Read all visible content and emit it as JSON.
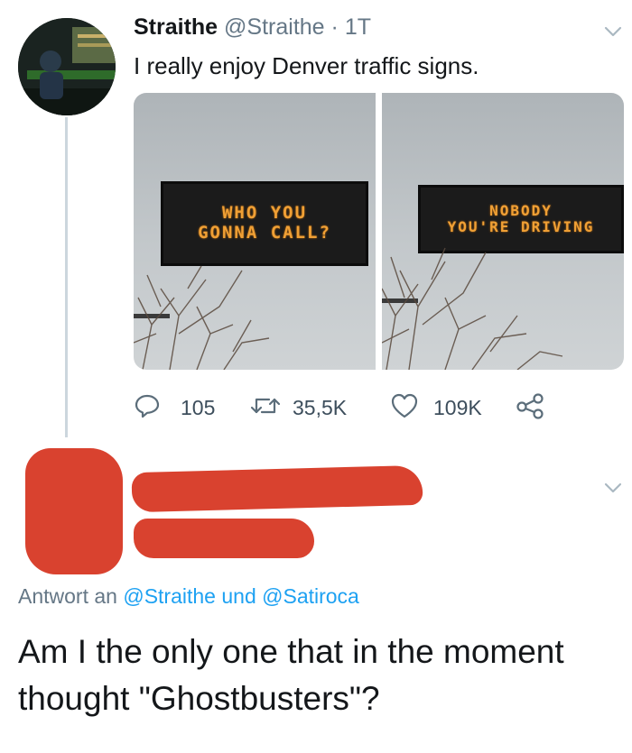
{
  "tweet": {
    "author_name": "Straithe",
    "author_handle": "@Straithe",
    "separator": "·",
    "time": "1T",
    "text": "I really enjoy Denver traffic signs.",
    "photos": [
      {
        "sign_line1": "WHO YOU",
        "sign_line2": "GONNA CALL?"
      },
      {
        "sign_line1": "NOBODY",
        "sign_line2": "YOU'RE DRIVING"
      }
    ],
    "actions": {
      "replies": "105",
      "retweets": "35,5K",
      "likes": "109K"
    }
  },
  "reply": {
    "prefix": "Antwort an",
    "mention1": "@Straithe",
    "conjunction": "und",
    "mention2": "@Satiroca",
    "text": "Am I the only one that in the moment thought \"Ghostbusters\"?"
  },
  "colors": {
    "accent": "#1da1f2",
    "redaction": "#d9422f",
    "sign_led": "#f0a035"
  },
  "icons": [
    "chevron-down-icon",
    "reply-icon",
    "retweet-icon",
    "heart-icon",
    "share-icon"
  ]
}
